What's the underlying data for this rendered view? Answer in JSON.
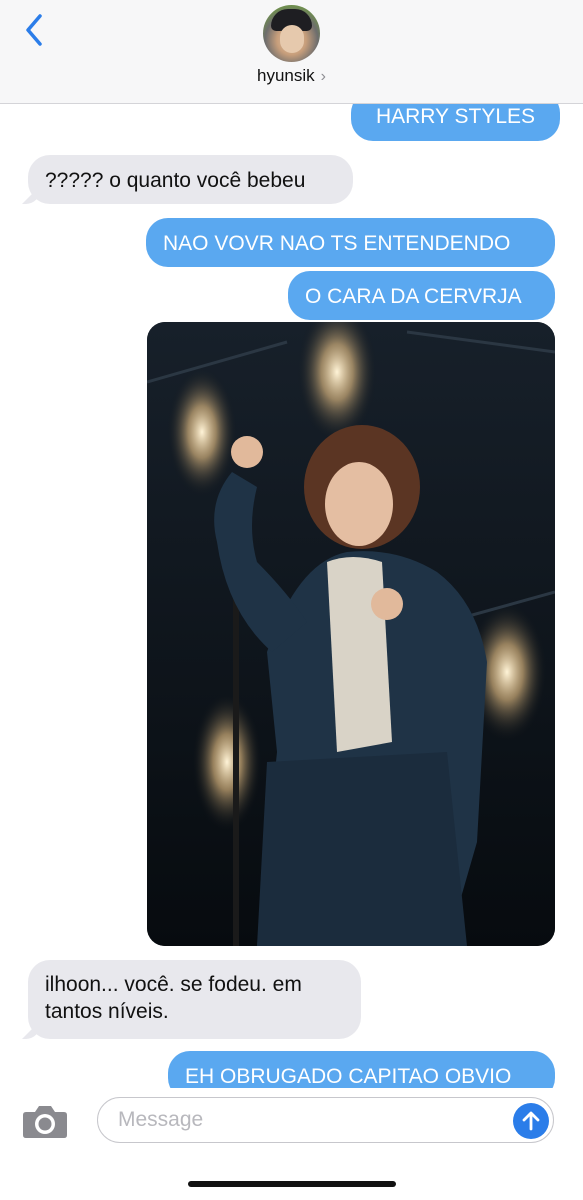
{
  "header": {
    "contact_name": "hyunsik",
    "chevron": "›",
    "back_icon": "chevron-left-icon"
  },
  "messages": [
    {
      "sender": "me",
      "text": "HARRY STYLES"
    },
    {
      "sender": "contact",
      "text": "????? o quanto você bebeu"
    },
    {
      "sender": "me",
      "text": "NAO VOVR NAO TS ENTENDENDO"
    },
    {
      "sender": "me",
      "text": "O CARA DA CERVRJA"
    },
    {
      "sender": "me",
      "type": "photo",
      "alt": "concert photo"
    },
    {
      "sender": "contact",
      "text": "ilhoon... você. se fodeu. em tantos níveis."
    },
    {
      "sender": "me",
      "text": "EH OBRUGADO CAPITAO OBVIO"
    }
  ],
  "composer": {
    "placeholder": "Message",
    "camera_icon": "camera-icon",
    "send_icon": "arrow-up-icon"
  },
  "colors": {
    "outgoing_bubble": "#5aa8f0",
    "incoming_bubble": "#e8e8ed",
    "accent": "#2b7de9"
  }
}
